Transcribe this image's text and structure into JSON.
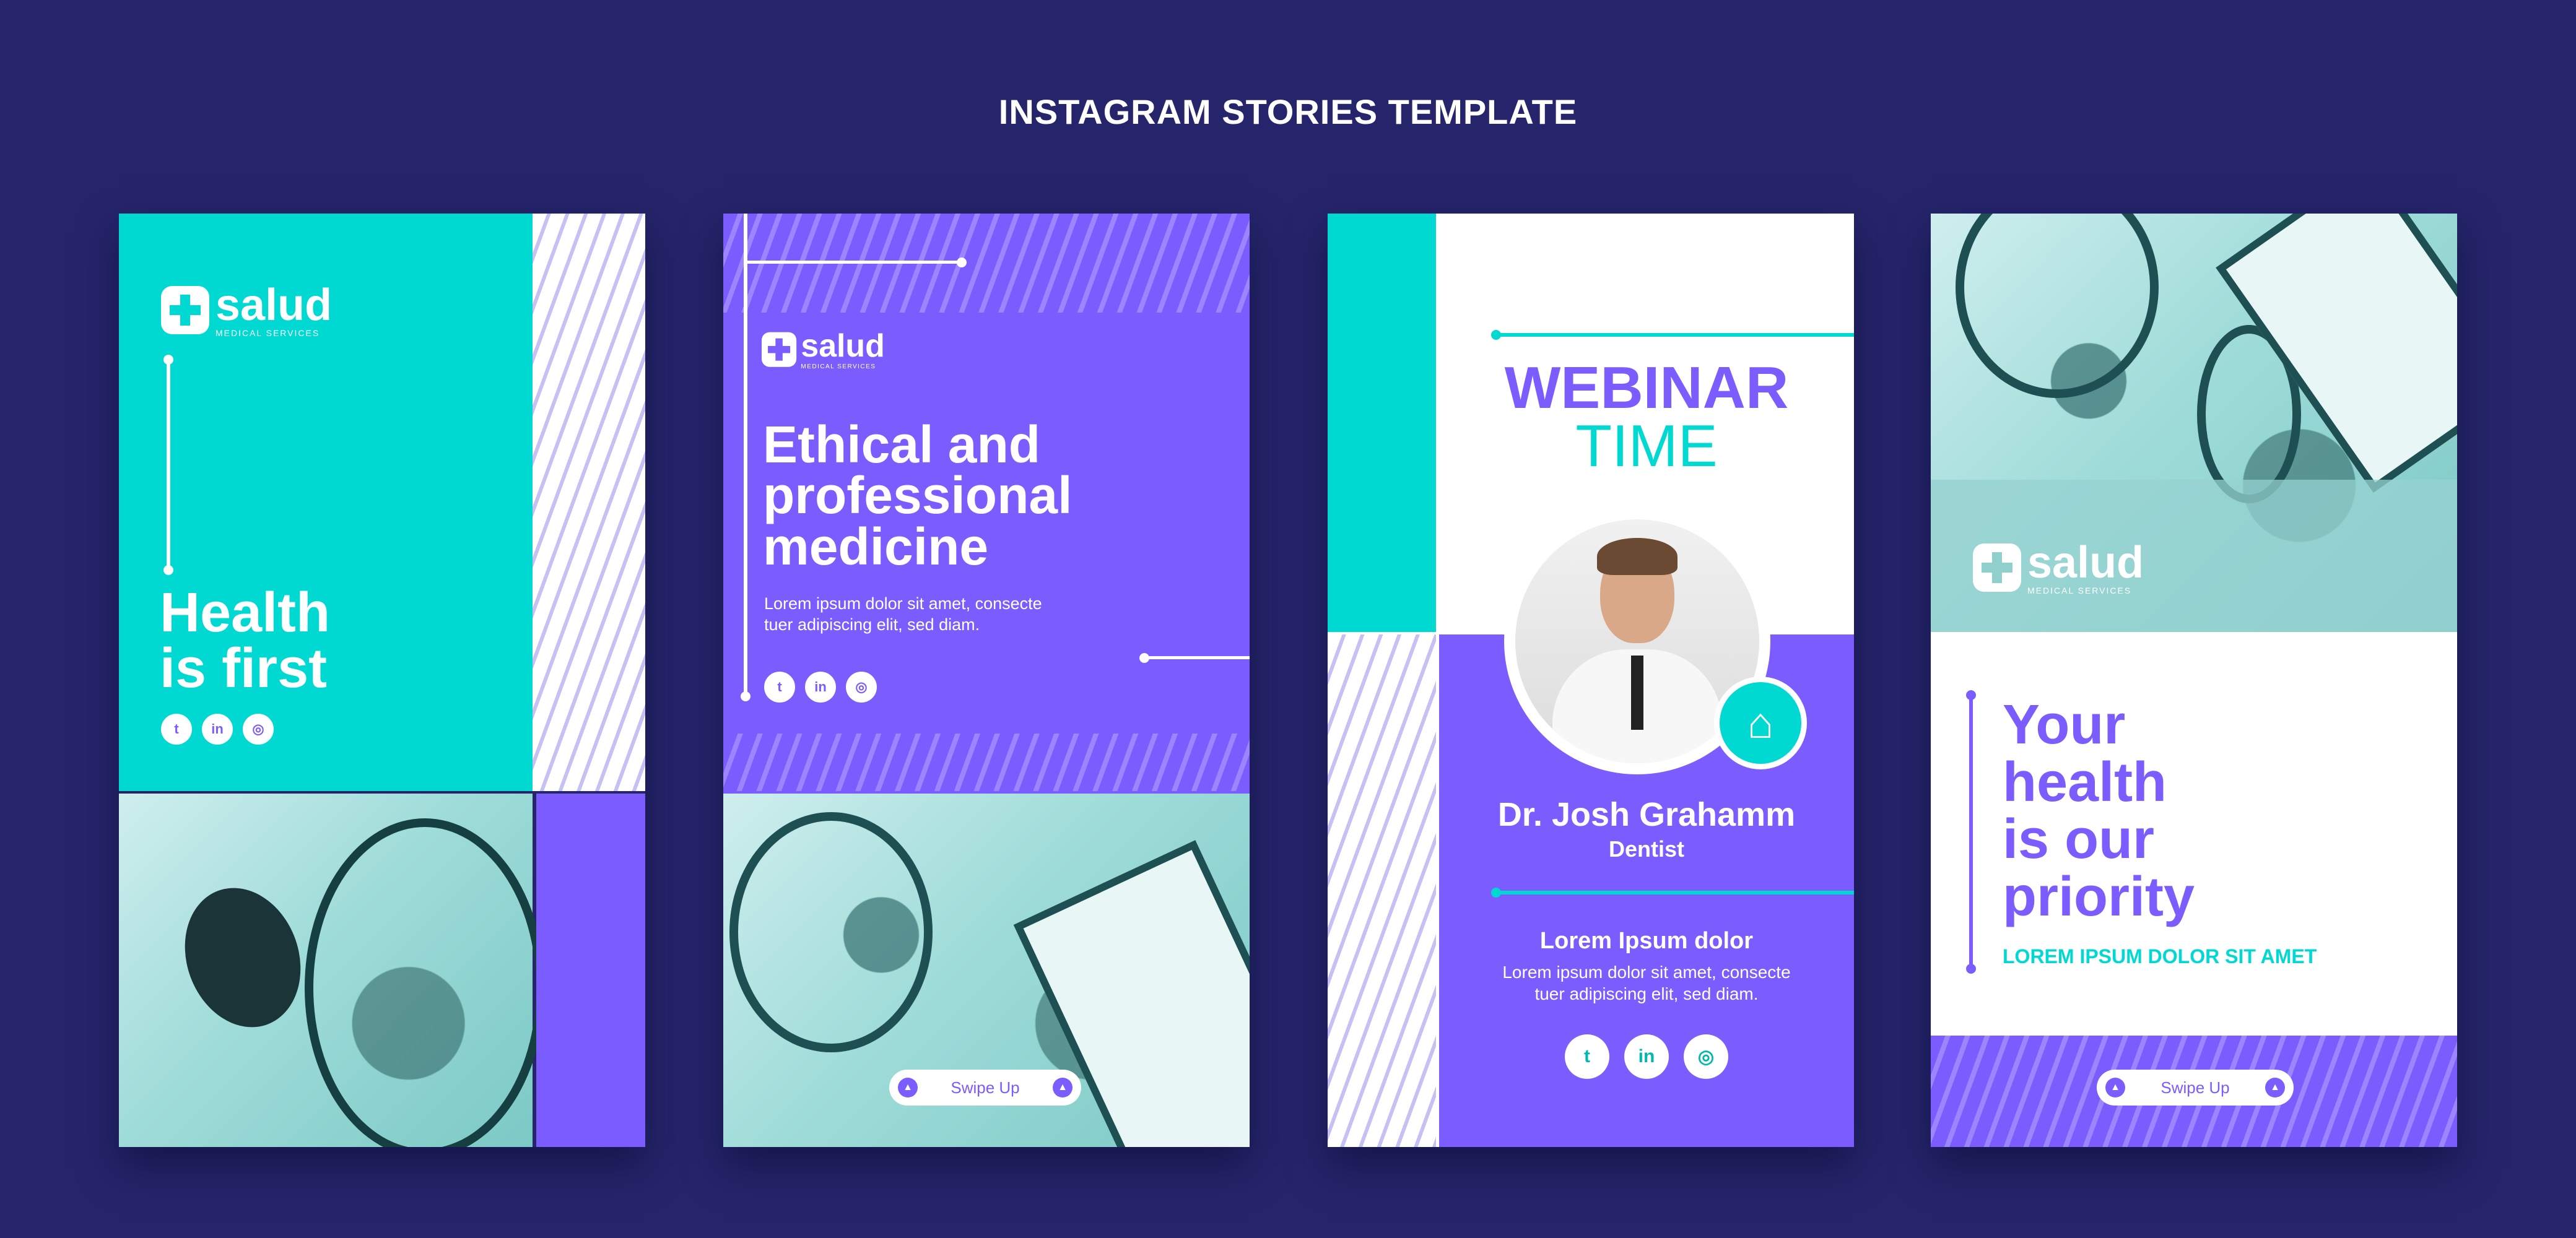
{
  "page": {
    "title": "INSTAGRAM STORIES TEMPLATE"
  },
  "colors": {
    "background": "#26256b",
    "teal": "#00d9d1",
    "purple": "#7b5cff",
    "white": "#ffffff"
  },
  "brand": {
    "name": "salud",
    "tagline": "MEDICAL SERVICES"
  },
  "social_icons": [
    "twitter-icon",
    "linkedin-icon",
    "instagram-icon"
  ],
  "story1": {
    "headline_line1": "Health",
    "headline_line2": "is first"
  },
  "story2": {
    "headline_line1": "Ethical and",
    "headline_line2": "professional",
    "headline_line3": "medicine",
    "body_line1": "Lorem ipsum dolor sit amet, consecte",
    "body_line2": "tuer adipiscing elit, sed diam.",
    "swipe_label": "Swipe Up"
  },
  "story3": {
    "title_line1": "WEBINAR",
    "title_line2": "TIME",
    "speaker_name": "Dr. Josh Grahamm",
    "speaker_role": "Dentist",
    "subheading": "Lorem Ipsum dolor",
    "body_line1": "Lorem ipsum dolor sit amet, consecte",
    "body_line2": "tuer adipiscing elit, sed diam."
  },
  "story4": {
    "headline_line1": "Your",
    "headline_line2": "health",
    "headline_line3": "is our",
    "headline_line4": "priority",
    "tagline": "LOREM IPSUM DOLOR SIT AMET",
    "swipe_label": "Swipe Up"
  }
}
